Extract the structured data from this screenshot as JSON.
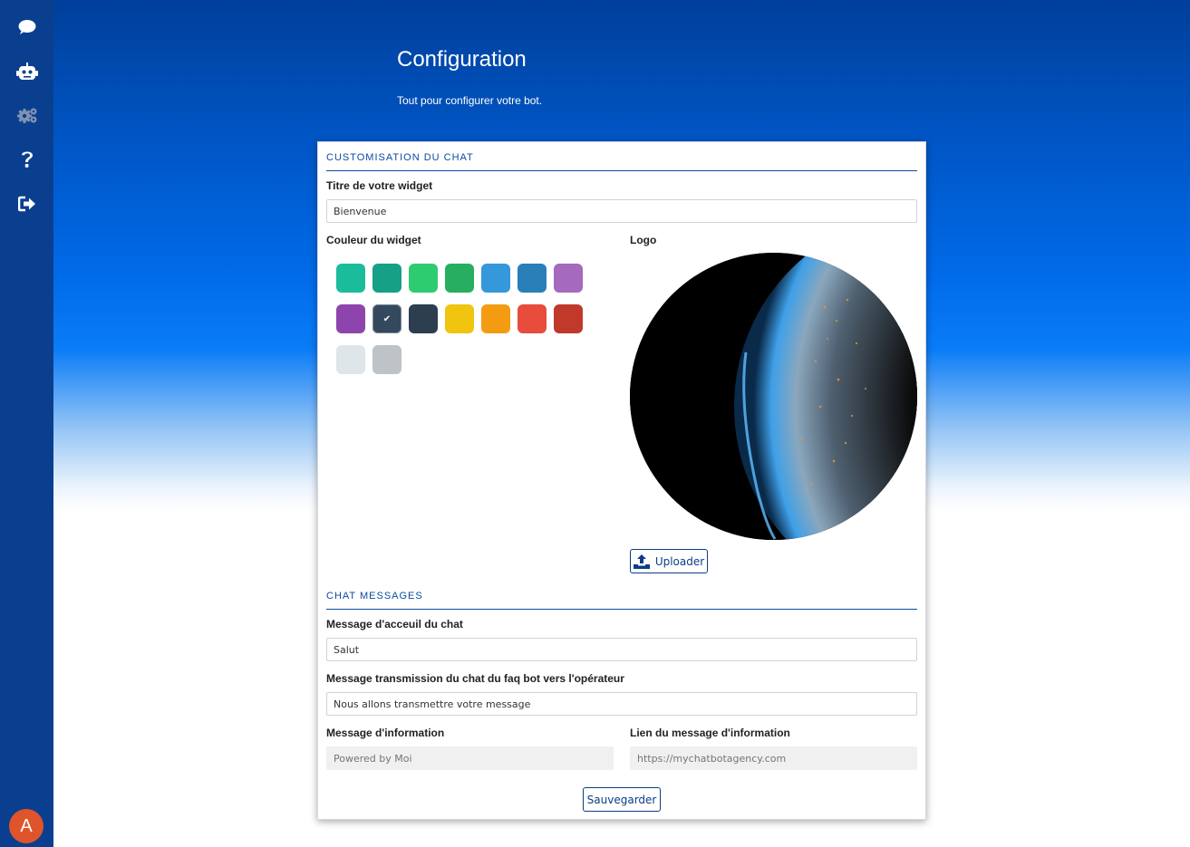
{
  "sidebar": {
    "items": [
      {
        "icon": "chat-bubble-icon"
      },
      {
        "icon": "robot-icon"
      },
      {
        "icon": "gears-icon"
      },
      {
        "icon": "question-icon"
      },
      {
        "icon": "sign-out-icon"
      }
    ],
    "avatar_initial": "A"
  },
  "header": {
    "title": "Configuration",
    "subtitle": "Tout pour configurer votre bot."
  },
  "customisation": {
    "section_title": "CUSTOMISATION DU CHAT",
    "widget_title_label": "Titre de votre widget",
    "widget_title_value": "Bienvenue",
    "color_label": "Couleur du widget",
    "colors": [
      "#1abc9c",
      "#16a085",
      "#2ecc71",
      "#27ae60",
      "#3498db",
      "#2980b9",
      "#a569bd",
      "#8e44ad",
      "#34495e",
      "#2c3e50",
      "#f1c40f",
      "#f39c12",
      "#e74c3c",
      "#c0392b",
      "#dfe6e9",
      "#bdc3c7"
    ],
    "selected_color_index": 8,
    "selected_mark": "✔",
    "logo_label": "Logo",
    "upload_label": "Uploader"
  },
  "messages": {
    "section_title": "CHAT MESSAGES",
    "welcome_label": "Message d'acceuil du chat",
    "welcome_value": "Salut",
    "transfer_label": "Message transmission du chat du faq bot vers l'opérateur",
    "transfer_value": "Nous allons transmettre votre message",
    "info_label": "Message d'information",
    "info_placeholder": "Powered by Moi",
    "info_link_label": "Lien du message d'information",
    "info_link_placeholder": "https://mychatbotagency.com",
    "save_label": "Sauvegarder"
  }
}
